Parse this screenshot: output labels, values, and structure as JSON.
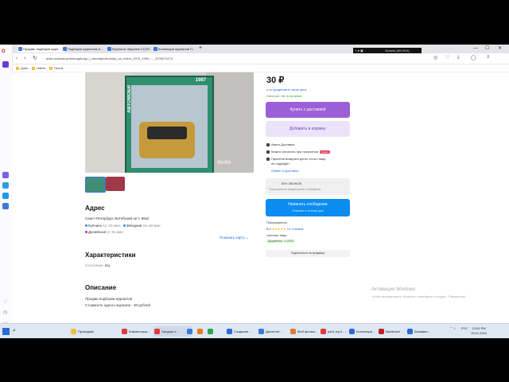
{
  "browser": {
    "tabs": [
      {
        "label": "Продам: подборки журн..."
      },
      {
        "label": "Подборки журналов А..."
      },
      {
        "label": "Журналы Зарулем СССР..."
      },
      {
        "label": "Коллекция журналов П..."
      }
    ],
    "new_tab": "+",
    "overlay_title": "Зелела (00:00:0)",
    "url": "avito.ru/sankt-peterburg/knigi_i_zhurnaly/zhurnaly_za_rulem_1976_1990_..._3709071173"
  },
  "bookmarks": [
    {
      "label": "Дзен"
    },
    {
      "label": "Найти"
    },
    {
      "label": "Почта"
    }
  ],
  "listing": {
    "price": "30 ₽",
    "price_suggest_prefix": "или",
    "price_suggest_link": "предложите свою цену",
    "availability_label": "Наличие:",
    "availability_value": "нет в наличии",
    "buy_button": "Купить с доставкой",
    "cart_button": "Добавить в корзину",
    "features": [
      {
        "text": "Авито Доставка",
        "badge": ""
      },
      {
        "text": "Можно оплатить при получении",
        "badge": "Новое"
      },
      {
        "text": "Гарантия возврата денег, если товар",
        "badge": ""
      },
      {
        "text": "не подойдёт",
        "badge": ""
      }
    ],
    "delivery_link": "Обмен и Доставка",
    "no_calls_title": "Без звонков",
    "no_calls_sub": "Пользователь предпочитает сообщения",
    "message_button": "Написать сообщение",
    "message_sub": "Отвечает в течение дня",
    "seller_label": "Пользователь",
    "rating_value": "5.0",
    "stars": "★★★★★",
    "reviews": "14 отзывов",
    "seller_type": "Частное лицо",
    "docs_badge": "Документы · с 2020",
    "subscribe_button": "Подписаться на продавца",
    "photo_watermark": "Avito",
    "magazine_year": "1987",
    "magazine_side": "АВТОМОБИ"
  },
  "address": {
    "heading": "Адрес",
    "city": "Санкт-Петербург, Витебский пр-т, 85к2",
    "metro": [
      {
        "name": "Купчино",
        "time": "11–15 мин.",
        "color": "#1e90ff"
      },
      {
        "name": "Звёздная",
        "time": "16–20 мин.",
        "color": "#1e90ff"
      },
      {
        "name": "Дунайская",
        "time": "от 31 мин.",
        "color": "#8b3ac9"
      }
    ],
    "map_link": "Показать карту ⌄"
  },
  "specs": {
    "heading": "Характеристики",
    "condition_label": "Состояние:",
    "condition_value": "Б/у"
  },
  "description": {
    "heading": "Описание",
    "lines": [
      "Продаю подборки журналов",
      "Стоимость одного журнала - 30 рублей"
    ]
  },
  "windows": {
    "activate_title": "Активация Windows",
    "activate_sub": "Чтобы активировать Windows, перейдите в раздел \"Параметры\"."
  },
  "taskbar": {
    "items": [
      {
        "label": "Проводник",
        "color": "#f0c040"
      },
      {
        "label": "Комментари...",
        "color": "#e03a3a"
      },
      {
        "label": "Продам п...",
        "color": "#e03a3a"
      },
      {
        "label": "",
        "color": "#3a7bd5"
      },
      {
        "label": "",
        "color": "#f07a20"
      },
      {
        "label": "",
        "color": "#2aa84a"
      },
      {
        "label": "Создание ...",
        "color": "#2a6ad8"
      },
      {
        "label": "Диспетче...",
        "color": "#3a7bd5"
      },
      {
        "label": "Мой фильм...",
        "color": "#e07a3a"
      },
      {
        "label": "pan1.mp4 - ...",
        "color": "#e03a3a"
      },
      {
        "label": "Коллекции...",
        "color": "#2a6ad8"
      },
      {
        "label": "Bandicam",
        "color": "#c02020"
      },
      {
        "label": "Безымян...",
        "color": "#2a6ad8"
      }
    ],
    "time": "13:51 PM",
    "date": "15.01.2024",
    "lang": "РУС"
  },
  "colors": {
    "accent_purple": "#9c5fd8",
    "accent_blue": "#0a8cf0",
    "link": "#1e6ae0"
  }
}
